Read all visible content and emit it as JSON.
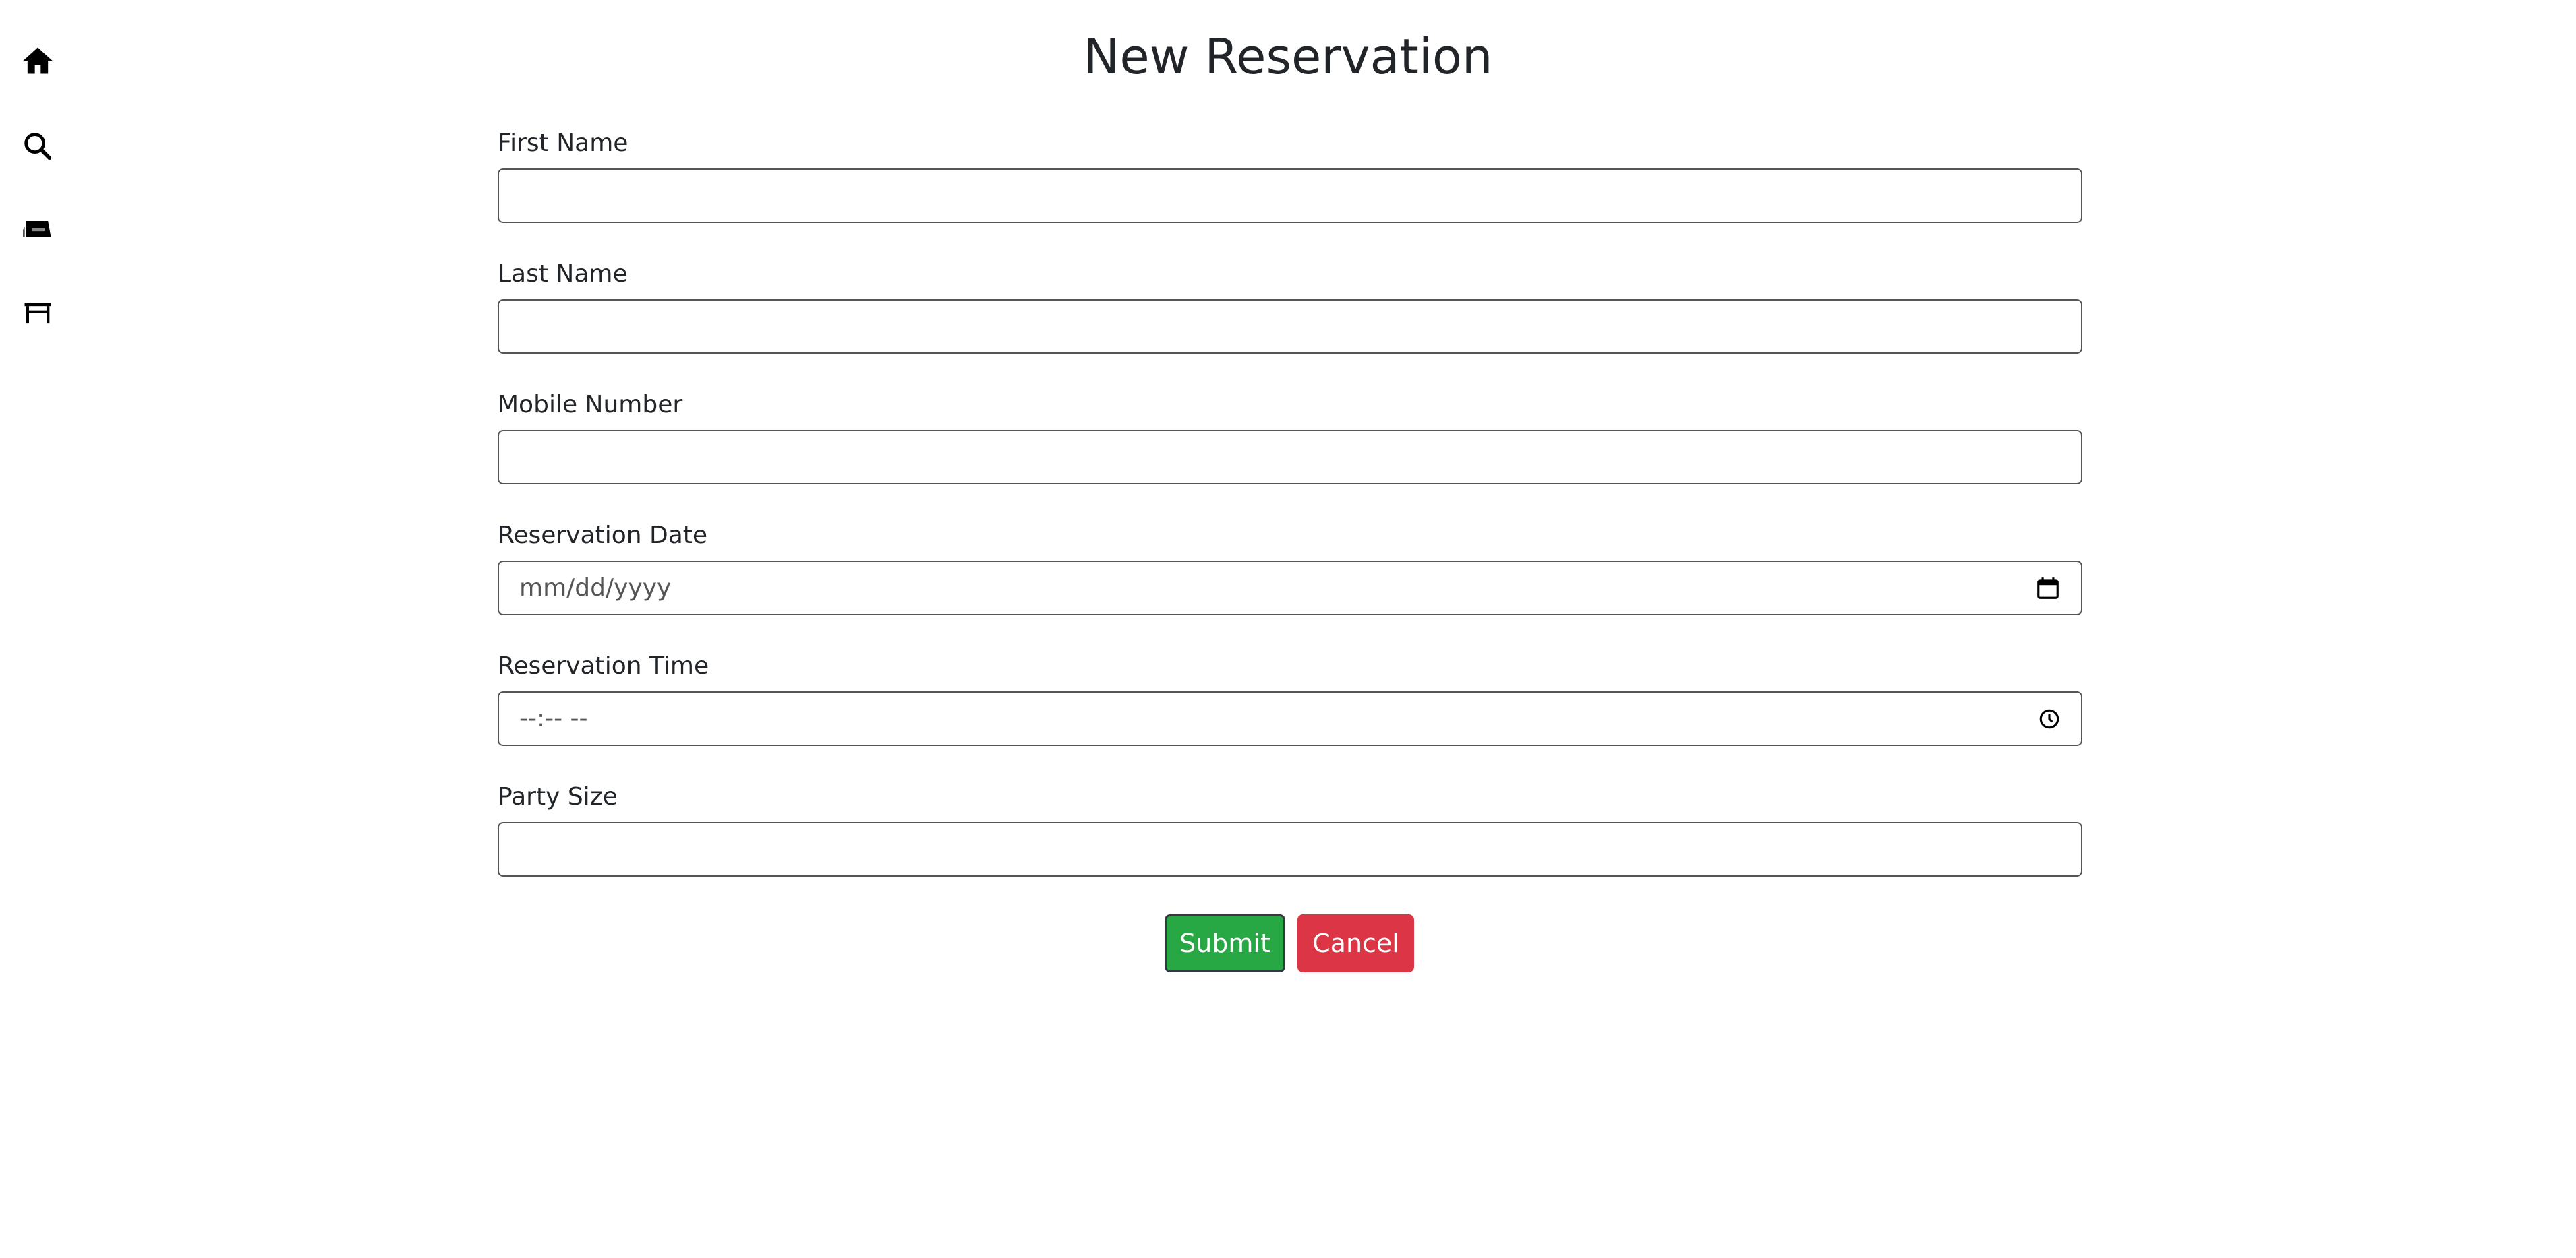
{
  "sidebar": {
    "items": [
      {
        "icon": "home-icon"
      },
      {
        "icon": "search-icon"
      },
      {
        "icon": "reservation-sign-icon"
      },
      {
        "icon": "table-icon"
      }
    ]
  },
  "page": {
    "title": "New Reservation"
  },
  "form": {
    "first_name": {
      "label": "First Name",
      "value": ""
    },
    "last_name": {
      "label": "Last Name",
      "value": ""
    },
    "mobile_number": {
      "label": "Mobile Number",
      "value": ""
    },
    "reservation_date": {
      "label": "Reservation Date",
      "placeholder": "mm/dd/yyyy"
    },
    "reservation_time": {
      "label": "Reservation Time",
      "placeholder": "--:-- --"
    },
    "party_size": {
      "label": "Party Size",
      "value": ""
    }
  },
  "buttons": {
    "submit": "Submit",
    "cancel": "Cancel"
  },
  "colors": {
    "submit": "#28a745",
    "cancel": "#dc3545"
  }
}
